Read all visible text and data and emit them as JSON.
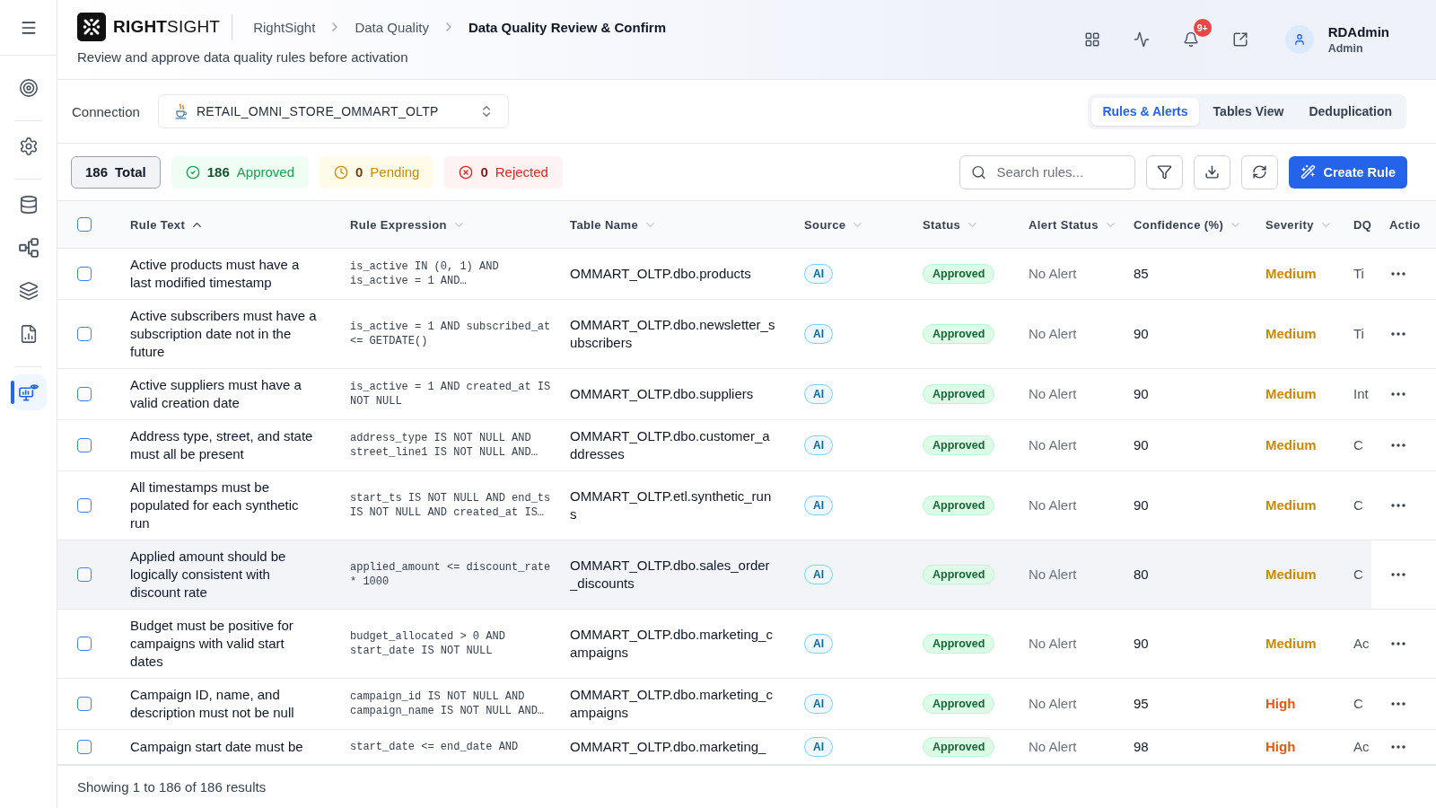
{
  "sidebar": {
    "groups": [
      {
        "items": [
          {
            "selected": false
          }
        ]
      },
      {
        "items": [
          {
            "selected": false
          }
        ]
      },
      {
        "items": [
          {
            "selected": false
          },
          {
            "selected": false
          },
          {
            "selected": false
          },
          {
            "selected": false
          }
        ]
      },
      {
        "items": [
          {
            "selected": true
          }
        ]
      }
    ]
  },
  "header": {
    "logo": "**RIGHT**SIGHT",
    "breadcrumbs": [
      {
        "label": "RightSight",
        "current": false
      },
      {
        "label": "Data Quality",
        "current": false
      },
      {
        "label": "Data Quality Review & Confirm",
        "current": true
      }
    ],
    "subtitle": "Review and approve data quality rules before activation",
    "notification_badge": "9+",
    "user": {
      "name": "RDAdmin",
      "role": "Admin"
    }
  },
  "connection": {
    "label": "Connection",
    "value": "RETAIL_OMNI_STORE_OMMART_OLTP"
  },
  "view_tabs": [
    {
      "label": "Rules & Alerts",
      "selected": true
    },
    {
      "label": "Tables View",
      "selected": false
    },
    {
      "label": "Deduplication",
      "selected": false
    }
  ],
  "summary": [
    {
      "kind": "total",
      "count": "186",
      "label": "Total",
      "selected": true
    },
    {
      "kind": "approved",
      "count": "186",
      "label": "Approved",
      "selected": false
    },
    {
      "kind": "pending",
      "count": "0",
      "label": "Pending",
      "selected": false
    },
    {
      "kind": "rejected",
      "count": "0",
      "label": "Rejected",
      "selected": false
    }
  ],
  "search": {
    "placeholder": "Search rules..."
  },
  "create_button": "Create Rule",
  "table": {
    "select_all_checked": false,
    "columns": [
      {
        "label": "Rule Text",
        "sortable": true,
        "sorted": true
      },
      {
        "label": "Rule Expression",
        "sortable": true,
        "sorted": false
      },
      {
        "label": "Table Name",
        "sortable": true,
        "sorted": false
      },
      {
        "label": "Source",
        "sortable": true,
        "sorted": false
      },
      {
        "label": "Status",
        "sortable": true,
        "sorted": false
      },
      {
        "label": "Alert Status",
        "sortable": true,
        "sorted": false
      },
      {
        "label": "Confidence (%)",
        "sortable": true,
        "sorted": false
      },
      {
        "label": "Severity",
        "sortable": true,
        "sorted": false
      },
      {
        "label": "DQ",
        "sortable": false,
        "sorted": false
      },
      {
        "label": "Actio",
        "sortable": false,
        "sorted": false
      }
    ],
    "rows": [
      {
        "checked": false,
        "hovered": false,
        "rule_text": "Active products must have a last modified timestamp",
        "expression": "is_active IN (0, 1) AND is_active = 1 AND…",
        "table_name": "OMMART_OLTP.dbo.products",
        "source": {
          "label": "AI",
          "kind": "ai"
        },
        "status": {
          "label": "Approved",
          "kind": "approved"
        },
        "alert_status": "No Alert",
        "confidence": "85",
        "severity": {
          "label": "Medium",
          "kind": "medium"
        },
        "dq": "Ti"
      },
      {
        "checked": false,
        "hovered": false,
        "rule_text": "Active subscribers must have a subscription date not in the future",
        "expression": "is_active = 1 AND subscribed_at <= GETDATE()",
        "table_name": "OMMART_OLTP.dbo.newsletter_subscribers",
        "source": {
          "label": "AI",
          "kind": "ai"
        },
        "status": {
          "label": "Approved",
          "kind": "approved"
        },
        "alert_status": "No Alert",
        "confidence": "90",
        "severity": {
          "label": "Medium",
          "kind": "medium"
        },
        "dq": "Ti"
      },
      {
        "checked": false,
        "hovered": false,
        "rule_text": "Active suppliers must have a valid creation date",
        "expression": "is_active = 1 AND created_at IS NOT NULL",
        "table_name": "OMMART_OLTP.dbo.suppliers",
        "source": {
          "label": "AI",
          "kind": "ai"
        },
        "status": {
          "label": "Approved",
          "kind": "approved"
        },
        "alert_status": "No Alert",
        "confidence": "90",
        "severity": {
          "label": "Medium",
          "kind": "medium"
        },
        "dq": "Int"
      },
      {
        "checked": false,
        "hovered": false,
        "rule_text": "Address type, street, and state must all be present",
        "expression": "address_type IS NOT NULL AND street_line1 IS NOT NULL AND…",
        "table_name": "OMMART_OLTP.dbo.customer_addresses",
        "source": {
          "label": "AI",
          "kind": "ai"
        },
        "status": {
          "label": "Approved",
          "kind": "approved"
        },
        "alert_status": "No Alert",
        "confidence": "90",
        "severity": {
          "label": "Medium",
          "kind": "medium"
        },
        "dq": "C"
      },
      {
        "checked": false,
        "hovered": false,
        "rule_text": "All timestamps must be populated for each synthetic run",
        "expression": "start_ts IS NOT NULL AND end_ts IS NOT NULL AND created_at IS…",
        "table_name": "OMMART_OLTP.etl.synthetic_runs",
        "source": {
          "label": "AI",
          "kind": "ai"
        },
        "status": {
          "label": "Approved",
          "kind": "approved"
        },
        "alert_status": "No Alert",
        "confidence": "90",
        "severity": {
          "label": "Medium",
          "kind": "medium"
        },
        "dq": "C"
      },
      {
        "checked": false,
        "hovered": true,
        "rule_text": "Applied amount should be logically consistent with discount rate",
        "expression": "applied_amount <= discount_rate * 1000",
        "table_name": "OMMART_OLTP.dbo.sales_order_discounts",
        "source": {
          "label": "AI",
          "kind": "ai"
        },
        "status": {
          "label": "Approved",
          "kind": "approved"
        },
        "alert_status": "No Alert",
        "confidence": "80",
        "severity": {
          "label": "Medium",
          "kind": "medium"
        },
        "dq": "C"
      },
      {
        "checked": false,
        "hovered": false,
        "rule_text": "Budget must be positive for campaigns with valid start dates",
        "expression": "budget_allocated > 0 AND start_date IS NOT NULL",
        "table_name": "OMMART_OLTP.dbo.marketing_campaigns",
        "source": {
          "label": "AI",
          "kind": "ai"
        },
        "status": {
          "label": "Approved",
          "kind": "approved"
        },
        "alert_status": "No Alert",
        "confidence": "90",
        "severity": {
          "label": "Medium",
          "kind": "medium"
        },
        "dq": "Ac"
      },
      {
        "checked": false,
        "hovered": false,
        "rule_text": "Campaign ID, name, and description must not be null",
        "expression": "campaign_id IS NOT NULL AND campaign_name IS NOT NULL AND…",
        "table_name": "OMMART_OLTP.dbo.marketing_campaigns",
        "source": {
          "label": "AI",
          "kind": "ai"
        },
        "status": {
          "label": "Approved",
          "kind": "approved"
        },
        "alert_status": "No Alert",
        "confidence": "95",
        "severity": {
          "label": "High",
          "kind": "high"
        },
        "dq": "C"
      },
      {
        "checked": false,
        "hovered": false,
        "rule_text": "Campaign start date must be",
        "expression": "start_date <= end_date AND",
        "table_name": "OMMART_OLTP.dbo.marketing_",
        "source": {
          "label": "AI",
          "kind": "ai"
        },
        "status": {
          "label": "Approved",
          "kind": "approved"
        },
        "alert_status": "No Alert",
        "confidence": "98",
        "severity": {
          "label": "High",
          "kind": "high"
        },
        "dq": "Ac"
      }
    ]
  },
  "footer": "Showing 1 to 186 of 186 results"
}
